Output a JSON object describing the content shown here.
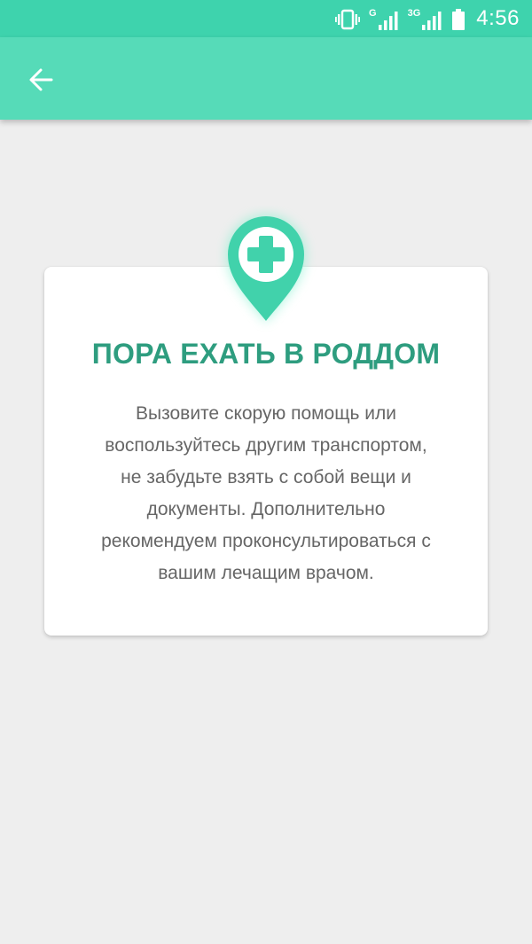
{
  "status_bar": {
    "network_1": "G",
    "network_2": "3G",
    "time": "4:56",
    "icons": [
      "vibrate-icon",
      "signal-icon",
      "signal-icon",
      "battery-icon"
    ]
  },
  "toolbar": {
    "back_icon": "arrow-left-icon"
  },
  "card": {
    "icon": "medical-pin-icon",
    "title": "ПОРА ЕХАТЬ В РОДДОМ",
    "body": "Вызовите скорую помощь или\nвоспользуйтесь другим транспортом,\nне забудьте взять с собой вещи и\nдокументы. Дополнительно\nрекомендуем проконсультироваться с\nвашим лечащим врачом."
  },
  "colors": {
    "status_bar": "#3ed3ad",
    "toolbar": "#56dbb8",
    "accent": "#2e9d7f",
    "background": "#eeeeee"
  }
}
